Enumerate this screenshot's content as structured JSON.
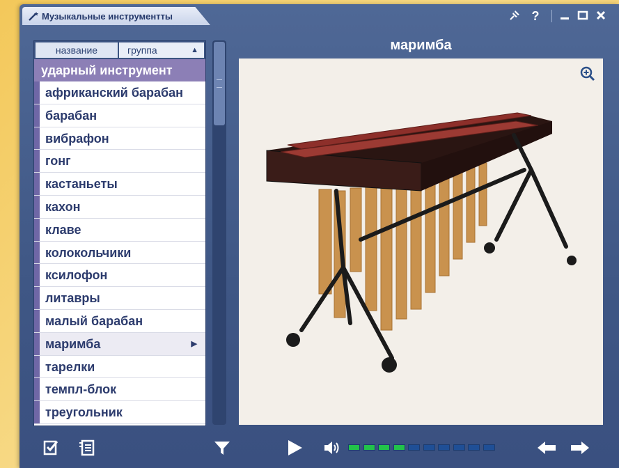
{
  "window": {
    "title": "Музыкальные инструментты",
    "accent": "#3f5785"
  },
  "titlebar_buttons": [
    "pin-icon",
    "help-icon",
    "minimize-icon",
    "maximize-icon",
    "close-icon"
  ],
  "list": {
    "header": {
      "name_label": "название",
      "group_label": "группа",
      "sort": "▲"
    },
    "group_heading": "ударный инструмент",
    "items": [
      {
        "label": "африканский барабан"
      },
      {
        "label": "барабан"
      },
      {
        "label": "вибрафон"
      },
      {
        "label": "гонг"
      },
      {
        "label": "кастаньеты"
      },
      {
        "label": "кахон"
      },
      {
        "label": "клаве"
      },
      {
        "label": "колокольчики"
      },
      {
        "label": "ксилофон"
      },
      {
        "label": "литавры"
      },
      {
        "label": "малый барабан"
      },
      {
        "label": "маримба",
        "selected": true
      },
      {
        "label": "тарелки"
      },
      {
        "label": "темпл-блок"
      },
      {
        "label": "треугольник"
      }
    ],
    "selected_marker": "▶"
  },
  "viewer": {
    "title": "маримба",
    "image": "marimba-instrument-photo"
  },
  "toolbar": {
    "volume_level": 0.4,
    "volume_segments": 10,
    "volume_on_color": "#22c24a",
    "volume_off_color": "#1f4f96"
  }
}
